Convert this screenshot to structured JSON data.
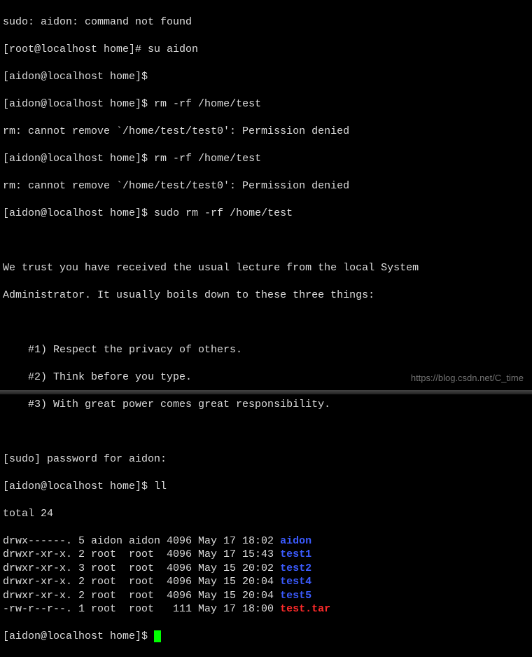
{
  "lines": {
    "l0": "sudo: aidon: command not found",
    "l1_prompt": "[root@localhost home]# ",
    "l1_cmd": "su aidon",
    "l2_prompt": "[aidon@localhost home]$",
    "l3_prompt": "[aidon@localhost home]$ ",
    "l3_cmd": "rm -rf /home/test",
    "l4": "rm: cannot remove `/home/test/test0': Permission denied",
    "l5_prompt": "[aidon@localhost home]$ ",
    "l5_cmd": "rm -rf /home/test",
    "l6": "rm: cannot remove `/home/test/test0': Permission denied",
    "l7_prompt": "[aidon@localhost home]$ ",
    "l7_cmd": "sudo rm -rf /home/test",
    "l8": "",
    "l9": "We trust you have received the usual lecture from the local System",
    "l10": "Administrator. It usually boils down to these three things:",
    "l11": "",
    "l12": "    #1) Respect the privacy of others.",
    "l13": "    #2) Think before you type.",
    "l14": "    #3) With great power comes great responsibility.",
    "l15": "",
    "l16": "[sudo] password for aidon:",
    "l17_prompt": "[aidon@localhost home]$ ",
    "l17_cmd": "ll",
    "l18": "total 24"
  },
  "listing": [
    {
      "perm": "drwx------. 5 aidon aidon 4096 May 17 18:02 ",
      "name": "aidon",
      "color": "blue"
    },
    {
      "perm": "drwxr-xr-x. 2 root  root  4096 May 17 15:43 ",
      "name": "test1",
      "color": "blue"
    },
    {
      "perm": "drwxr-xr-x. 3 root  root  4096 May 15 20:02 ",
      "name": "test2",
      "color": "blue"
    },
    {
      "perm": "drwxr-xr-x. 2 root  root  4096 May 15 20:04 ",
      "name": "test4",
      "color": "blue"
    },
    {
      "perm": "drwxr-xr-x. 2 root  root  4096 May 15 20:04 ",
      "name": "test5",
      "color": "blue"
    },
    {
      "perm": "-rw-r--r--. 1 root  root   111 May 17 18:00 ",
      "name": "test.tar",
      "color": "red"
    }
  ],
  "last_prompt": "[aidon@localhost home]$ ",
  "watermark": "https://blog.csdn.net/C_time"
}
